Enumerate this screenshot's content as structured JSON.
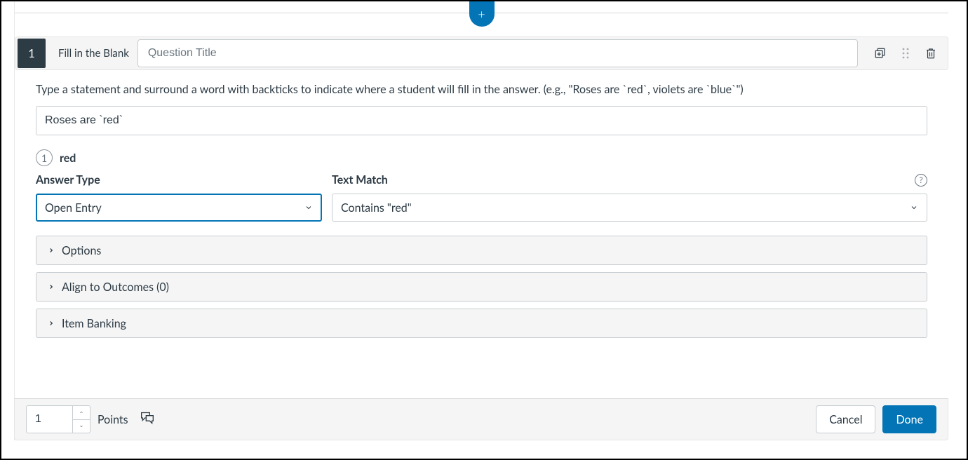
{
  "add_button_glyph": "+",
  "header": {
    "question_number": "1",
    "question_type": "Fill in the Blank",
    "title_placeholder": "Question Title",
    "title_value": ""
  },
  "instruction": "Type a statement and surround a word with backticks to indicate where a student will fill in the answer. (e.g., \"Roses are `red`, violets are `blue`\")",
  "statement_value": "Roses are `red`",
  "blank": {
    "index": "1",
    "word": "red"
  },
  "answer_type": {
    "label": "Answer Type",
    "selected": "Open Entry"
  },
  "text_match": {
    "label": "Text Match",
    "selected": "Contains \"red\""
  },
  "accordions": {
    "options": "Options",
    "outcomes": "Align to Outcomes (0)",
    "item_banking": "Item Banking"
  },
  "footer": {
    "points_value": "1",
    "points_label": "Points",
    "cancel": "Cancel",
    "done": "Done"
  }
}
